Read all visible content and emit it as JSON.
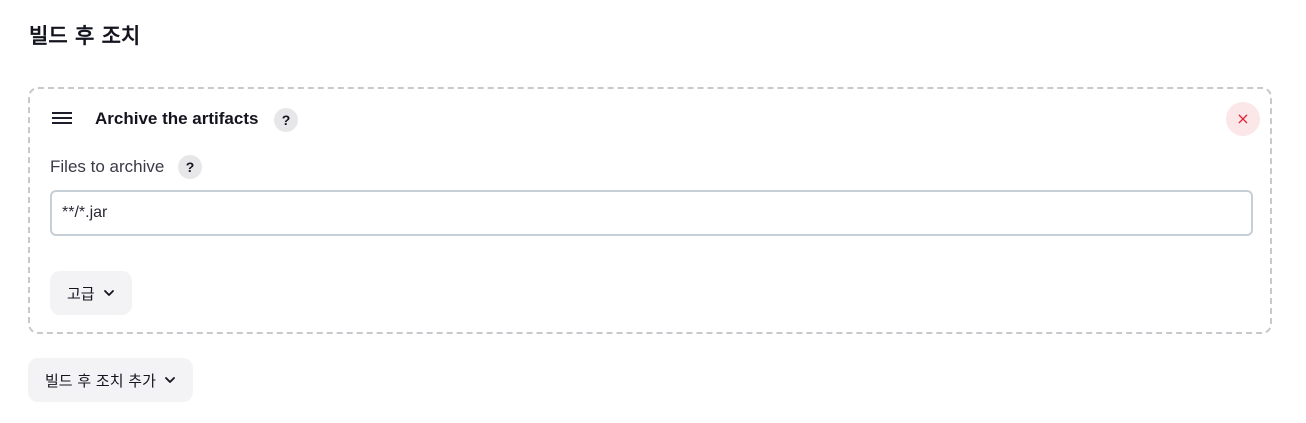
{
  "section": {
    "title": "빌드 후 조치"
  },
  "step": {
    "title": "Archive the artifacts",
    "help_icon": "?",
    "delete_icon": "×",
    "field": {
      "label": "Files to archive",
      "help_icon": "?",
      "value": "**/*.jar"
    },
    "advanced_label": "고급"
  },
  "add_step": {
    "label": "빌드 후 조치 추가"
  },
  "colors": {
    "delete_bg": "#fbe6e8",
    "delete_fg": "#e0263d",
    "button_bg": "#f3f3f6",
    "card_border": "#c7c9cd"
  },
  "icons": [
    "drag-handle-icon",
    "help-icon",
    "close-icon",
    "chevron-down-icon"
  ]
}
